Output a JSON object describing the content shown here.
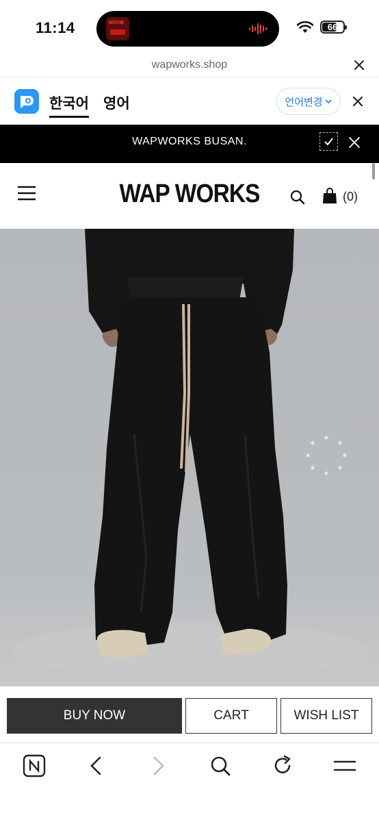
{
  "status_bar": {
    "time": "11:14",
    "island_thumb_label": "MOVIE",
    "battery_level": "66"
  },
  "browser": {
    "url": "wapworks.shop"
  },
  "translate_bar": {
    "lang_current": "한국어",
    "lang_target": "영어",
    "change_label": "언어변경"
  },
  "banner": {
    "text": "WAPWORKS BUSAN."
  },
  "header": {
    "logo": "WAP WORKS",
    "cart_count": "(0)"
  },
  "actions": {
    "buy_now": "BUY NOW",
    "cart": "CART",
    "wish_list": "WISH LIST"
  },
  "colors": {
    "accent_blue": "#2b79d8",
    "papago_blue": "#2b97f2",
    "buy_button_bg": "#333333",
    "banner_bg": "#000000",
    "photo_bg": "#b7babd"
  },
  "icons": [
    "wifi-icon",
    "battery-icon",
    "close-icon",
    "papago-icon",
    "chevron-down-icon",
    "check-icon",
    "menu-icon",
    "search-icon",
    "shopping-bag-icon",
    "loading-spinner-icon",
    "naver-home-icon",
    "back-icon",
    "forward-icon",
    "refresh-icon",
    "hamburger-icon"
  ]
}
